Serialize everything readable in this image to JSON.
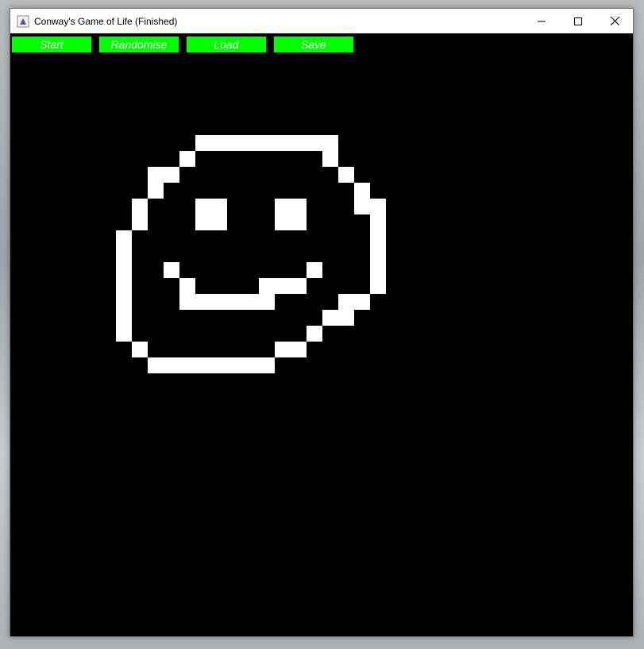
{
  "window": {
    "title": "Conway's Game of Life (Finished)"
  },
  "toolbar": {
    "start_label": "Start",
    "randomise_label": "Randomise",
    "load_label": "Load",
    "save_label": "Save"
  },
  "colors": {
    "button_bg": "#00ff00",
    "button_text": "#ffffff",
    "board_bg": "#000000",
    "live_cell": "#ffffff"
  },
  "board": {
    "live_cells": [
      [
        12,
        7
      ],
      [
        13,
        7
      ],
      [
        14,
        7
      ],
      [
        15,
        7
      ],
      [
        16,
        7
      ],
      [
        17,
        7
      ],
      [
        18,
        7
      ],
      [
        19,
        7
      ],
      [
        20,
        7
      ],
      [
        11,
        8
      ],
      [
        20,
        8
      ],
      [
        9,
        9
      ],
      [
        10,
        9
      ],
      [
        21,
        9
      ],
      [
        9,
        10
      ],
      [
        22,
        10
      ],
      [
        8,
        11
      ],
      [
        12,
        11
      ],
      [
        13,
        11
      ],
      [
        17,
        11
      ],
      [
        18,
        11
      ],
      [
        22,
        11
      ],
      [
        23,
        11
      ],
      [
        8,
        12
      ],
      [
        12,
        12
      ],
      [
        13,
        12
      ],
      [
        17,
        12
      ],
      [
        18,
        12
      ],
      [
        23,
        12
      ],
      [
        7,
        13
      ],
      [
        23,
        13
      ],
      [
        7,
        14
      ],
      [
        23,
        14
      ],
      [
        7,
        15
      ],
      [
        10,
        15
      ],
      [
        19,
        15
      ],
      [
        23,
        15
      ],
      [
        7,
        16
      ],
      [
        11,
        16
      ],
      [
        16,
        16
      ],
      [
        17,
        16
      ],
      [
        18,
        16
      ],
      [
        23,
        16
      ],
      [
        7,
        17
      ],
      [
        11,
        17
      ],
      [
        12,
        17
      ],
      [
        13,
        17
      ],
      [
        14,
        17
      ],
      [
        15,
        17
      ],
      [
        16,
        17
      ],
      [
        21,
        17
      ],
      [
        22,
        17
      ],
      [
        7,
        18
      ],
      [
        20,
        18
      ],
      [
        21,
        18
      ],
      [
        7,
        19
      ],
      [
        19,
        19
      ],
      [
        8,
        20
      ],
      [
        17,
        20
      ],
      [
        18,
        20
      ],
      [
        9,
        21
      ],
      [
        10,
        21
      ],
      [
        11,
        21
      ],
      [
        12,
        21
      ],
      [
        13,
        21
      ],
      [
        14,
        21
      ],
      [
        15,
        21
      ],
      [
        16,
        21
      ]
    ]
  }
}
